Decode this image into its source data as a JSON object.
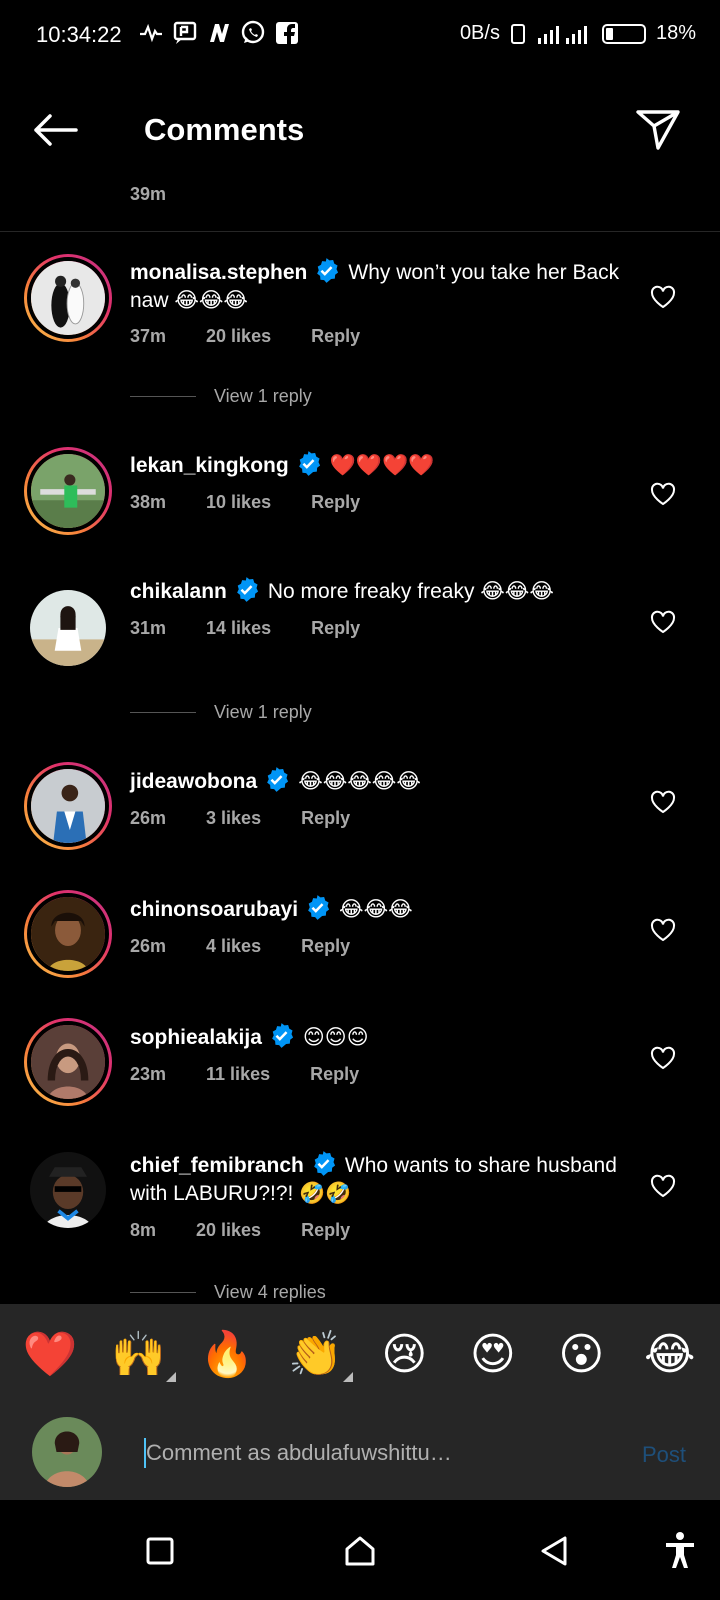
{
  "status": {
    "time": "10:34:22",
    "speed": "0B/s",
    "battery": "18%"
  },
  "header": {
    "title": "Comments"
  },
  "previous_time": "39m",
  "comments": [
    {
      "user": "monalisa.stephen",
      "text": "Why won’t you take her Back naw 😂😂😂",
      "time": "37m",
      "likes": "20 likes",
      "reply": "Reply",
      "view_replies": "View 1 reply"
    },
    {
      "user": "lekan_kingkong",
      "text": "❤️❤️❤️❤️",
      "time": "38m",
      "likes": "10 likes",
      "reply": "Reply"
    },
    {
      "user": "chikalann",
      "text": "No more freaky freaky 😂😂😂",
      "time": "31m",
      "likes": "14 likes",
      "reply": "Reply",
      "view_replies": "View 1 reply"
    },
    {
      "user": "jideawobona",
      "text": "😂😂😂😂😂",
      "time": "26m",
      "likes": "3 likes",
      "reply": "Reply"
    },
    {
      "user": "chinonsoarubayi",
      "text": "😂😂😂",
      "time": "26m",
      "likes": "4 likes",
      "reply": "Reply"
    },
    {
      "user": "sophiealakija",
      "text": "😊😊😊",
      "time": "23m",
      "likes": "11 likes",
      "reply": "Reply"
    },
    {
      "user": "chief_femibranch",
      "text": "Who wants to share husband with LABURU?!?! 🤣🤣",
      "time": "8m",
      "likes": "20 likes",
      "reply": "Reply",
      "view_replies": "View 4 replies"
    }
  ],
  "quick_emojis": [
    "❤️",
    "🙌",
    "🔥",
    "👏",
    "😢",
    "😍",
    "😮",
    "😂"
  ],
  "input": {
    "placeholder": "Comment as abdulafuwshittu…",
    "post_label": "Post"
  },
  "colors": {
    "background": "#000000",
    "secondary_text": "#a8a8a8",
    "verified_blue": "#0095f6",
    "panel": "#262626"
  }
}
